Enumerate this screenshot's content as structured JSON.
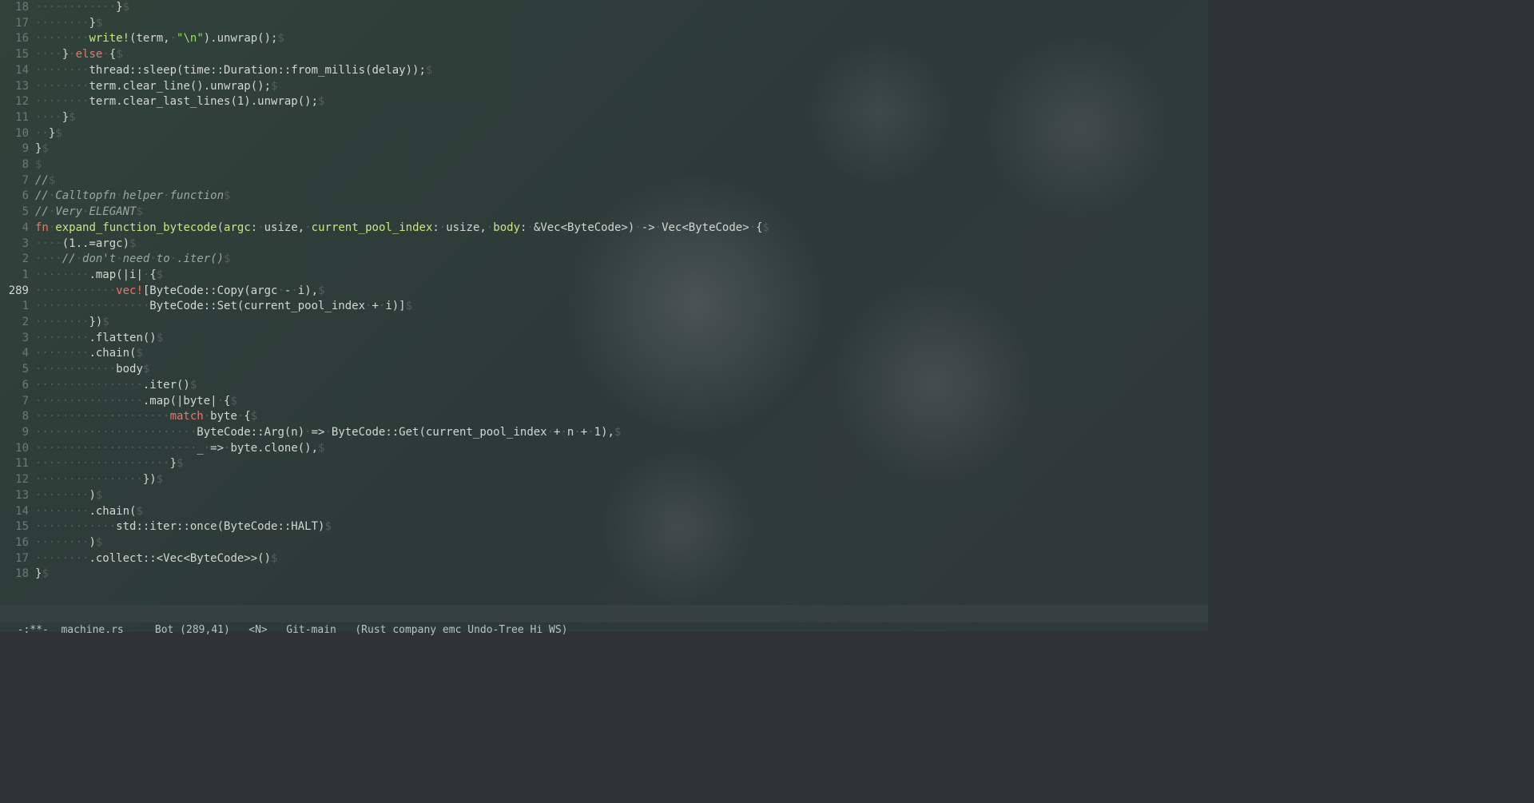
{
  "modeline": {
    "prefix": "-:**-  ",
    "filename": "machine.rs",
    "position": "Bot (289,41)",
    "mode_indicator": "<N>",
    "git": "Git-main",
    "modes": "(Rust company emc Undo-Tree Hi WS)"
  },
  "lines": [
    {
      "num": "18",
      "tokens": [
        [
          "ws",
          "············"
        ],
        [
          "punct",
          "}"
        ],
        [
          "eol",
          "$"
        ]
      ]
    },
    {
      "num": "17",
      "tokens": [
        [
          "ws",
          "········"
        ],
        [
          "punct",
          "}"
        ],
        [
          "eol",
          "$"
        ]
      ]
    },
    {
      "num": "16",
      "tokens": [
        [
          "ws",
          "········"
        ],
        [
          "fn-name",
          "write!"
        ],
        [
          "punct",
          "(term,"
        ],
        [
          "ws",
          "·"
        ],
        [
          "string",
          "\"\\n\""
        ],
        [
          "punct",
          ").unwrap();"
        ],
        [
          "eol",
          "$"
        ]
      ]
    },
    {
      "num": "15",
      "tokens": [
        [
          "ws",
          "····"
        ],
        [
          "punct",
          "}"
        ],
        [
          "ws",
          "·"
        ],
        [
          "kw",
          "else"
        ],
        [
          "ws",
          "·"
        ],
        [
          "punct",
          "{"
        ],
        [
          "eol",
          "$"
        ]
      ]
    },
    {
      "num": "14",
      "tokens": [
        [
          "ws",
          "········"
        ],
        [
          "punct",
          "thread::sleep(time::Duration::from_millis(delay));"
        ],
        [
          "eol",
          "$"
        ]
      ]
    },
    {
      "num": "13",
      "tokens": [
        [
          "ws",
          "········"
        ],
        [
          "punct",
          "term.clear_line().unwrap();"
        ],
        [
          "eol",
          "$"
        ]
      ]
    },
    {
      "num": "12",
      "tokens": [
        [
          "ws",
          "········"
        ],
        [
          "punct",
          "term.clear_last_lines(1).unwrap();"
        ],
        [
          "eol",
          "$"
        ]
      ]
    },
    {
      "num": "11",
      "tokens": [
        [
          "ws",
          "····"
        ],
        [
          "punct",
          "}"
        ],
        [
          "eol",
          "$"
        ]
      ]
    },
    {
      "num": "10",
      "tokens": [
        [
          "ws",
          "··"
        ],
        [
          "punct",
          "}"
        ],
        [
          "eol",
          "$"
        ]
      ]
    },
    {
      "num": "9",
      "tokens": [
        [
          "punct",
          "}"
        ],
        [
          "eol",
          "$"
        ]
      ]
    },
    {
      "num": "8",
      "tokens": [
        [
          "eol",
          "$"
        ]
      ]
    },
    {
      "num": "7",
      "tokens": [
        [
          "comment",
          "//"
        ],
        [
          "eol",
          "$"
        ]
      ]
    },
    {
      "num": "6",
      "tokens": [
        [
          "comment",
          "//"
        ],
        [
          "ws",
          "·"
        ],
        [
          "comment",
          "Calltopfn"
        ],
        [
          "ws",
          "·"
        ],
        [
          "comment",
          "helper"
        ],
        [
          "ws",
          "·"
        ],
        [
          "comment",
          "function"
        ],
        [
          "eol",
          "$"
        ]
      ]
    },
    {
      "num": "5",
      "tokens": [
        [
          "comment",
          "//"
        ],
        [
          "ws",
          "·"
        ],
        [
          "comment",
          "Very"
        ],
        [
          "ws",
          "·"
        ],
        [
          "comment",
          "ELEGANT"
        ],
        [
          "eol",
          "$"
        ]
      ]
    },
    {
      "num": "4",
      "tokens": [
        [
          "kw",
          "fn"
        ],
        [
          "ws",
          "·"
        ],
        [
          "fn-name",
          "expand_function_bytecode"
        ],
        [
          "punct",
          "("
        ],
        [
          "fn-name",
          "argc"
        ],
        [
          "punct",
          ":"
        ],
        [
          "ws",
          "·"
        ],
        [
          "type",
          "usize"
        ],
        [
          "punct",
          ","
        ],
        [
          "ws",
          "·"
        ],
        [
          "fn-name",
          "current_pool_index"
        ],
        [
          "punct",
          ":"
        ],
        [
          "ws",
          "·"
        ],
        [
          "type",
          "usize"
        ],
        [
          "punct",
          ","
        ],
        [
          "ws",
          "·"
        ],
        [
          "fn-name",
          "body"
        ],
        [
          "punct",
          ":"
        ],
        [
          "ws",
          "·"
        ],
        [
          "punct",
          "&"
        ],
        [
          "type",
          "Vec<ByteCode>"
        ],
        [
          "punct",
          ")"
        ],
        [
          "ws",
          "·"
        ],
        [
          "punct",
          "->"
        ],
        [
          "ws",
          "·"
        ],
        [
          "type",
          "Vec<ByteCode>"
        ],
        [
          "ws",
          "·"
        ],
        [
          "punct",
          "{"
        ],
        [
          "eol",
          "$"
        ]
      ]
    },
    {
      "num": "3",
      "tokens": [
        [
          "ws",
          "····"
        ],
        [
          "punct",
          "(1..=argc)"
        ],
        [
          "eol",
          "$"
        ]
      ]
    },
    {
      "num": "2",
      "tokens": [
        [
          "ws",
          "····"
        ],
        [
          "comment",
          "//"
        ],
        [
          "ws",
          "·"
        ],
        [
          "comment",
          "don't"
        ],
        [
          "ws",
          "·"
        ],
        [
          "comment",
          "need"
        ],
        [
          "ws",
          "·"
        ],
        [
          "comment",
          "to"
        ],
        [
          "ws",
          "·"
        ],
        [
          "comment",
          ".iter()"
        ],
        [
          "eol",
          "$"
        ]
      ]
    },
    {
      "num": "1",
      "tokens": [
        [
          "ws",
          "········"
        ],
        [
          "punct",
          ".map(|i|"
        ],
        [
          "ws",
          "·"
        ],
        [
          "punct",
          "{"
        ],
        [
          "eol",
          "$"
        ]
      ]
    },
    {
      "num": "289",
      "current": true,
      "tokens": [
        [
          "ws",
          "············"
        ],
        [
          "macro",
          "vec!"
        ],
        [
          "punct",
          "[ByteCode::Copy(argc"
        ],
        [
          "ws",
          "·"
        ],
        [
          "punct",
          "-"
        ],
        [
          "ws",
          "·"
        ],
        [
          "punct",
          "i),"
        ],
        [
          "eol",
          "$"
        ]
      ]
    },
    {
      "num": "1",
      "tokens": [
        [
          "ws",
          "·················"
        ],
        [
          "punct",
          "ByteCode::Set(current_pool_index"
        ],
        [
          "ws",
          "·"
        ],
        [
          "punct",
          "+"
        ],
        [
          "ws",
          "·"
        ],
        [
          "punct",
          "i)]"
        ],
        [
          "eol",
          "$"
        ]
      ]
    },
    {
      "num": "2",
      "tokens": [
        [
          "ws",
          "········"
        ],
        [
          "punct",
          "})"
        ],
        [
          "eol",
          "$"
        ]
      ]
    },
    {
      "num": "3",
      "tokens": [
        [
          "ws",
          "········"
        ],
        [
          "punct",
          ".flatten()"
        ],
        [
          "eol",
          "$"
        ]
      ]
    },
    {
      "num": "4",
      "tokens": [
        [
          "ws",
          "········"
        ],
        [
          "punct",
          ".chain("
        ],
        [
          "eol",
          "$"
        ]
      ]
    },
    {
      "num": "5",
      "tokens": [
        [
          "ws",
          "············"
        ],
        [
          "punct",
          "body"
        ],
        [
          "eol",
          "$"
        ]
      ]
    },
    {
      "num": "6",
      "tokens": [
        [
          "ws",
          "················"
        ],
        [
          "punct",
          ".iter()"
        ],
        [
          "eol",
          "$"
        ]
      ]
    },
    {
      "num": "7",
      "tokens": [
        [
          "ws",
          "················"
        ],
        [
          "punct",
          ".map(|byte|"
        ],
        [
          "ws",
          "·"
        ],
        [
          "punct",
          "{"
        ],
        [
          "eol",
          "$"
        ]
      ]
    },
    {
      "num": "8",
      "tokens": [
        [
          "ws",
          "····················"
        ],
        [
          "kw",
          "match"
        ],
        [
          "ws",
          "·"
        ],
        [
          "punct",
          "byte"
        ],
        [
          "ws",
          "·"
        ],
        [
          "punct",
          "{"
        ],
        [
          "eol",
          "$"
        ]
      ]
    },
    {
      "num": "9",
      "tokens": [
        [
          "ws",
          "························"
        ],
        [
          "punct",
          "ByteCode::Arg(n)"
        ],
        [
          "ws",
          "·"
        ],
        [
          "punct",
          "=>"
        ],
        [
          "ws",
          "·"
        ],
        [
          "punct",
          "ByteCode::Get(current_pool_index"
        ],
        [
          "ws",
          "·"
        ],
        [
          "punct",
          "+"
        ],
        [
          "ws",
          "·"
        ],
        [
          "punct",
          "n"
        ],
        [
          "ws",
          "·"
        ],
        [
          "punct",
          "+"
        ],
        [
          "ws",
          "·"
        ],
        [
          "punct",
          "1),"
        ],
        [
          "eol",
          "$"
        ]
      ]
    },
    {
      "num": "10",
      "tokens": [
        [
          "ws",
          "························"
        ],
        [
          "punct",
          "_"
        ],
        [
          "ws",
          "·"
        ],
        [
          "punct",
          "=>"
        ],
        [
          "ws",
          "·"
        ],
        [
          "punct",
          "byte.clone(),"
        ],
        [
          "eol",
          "$"
        ]
      ]
    },
    {
      "num": "11",
      "tokens": [
        [
          "ws",
          "····················"
        ],
        [
          "punct",
          "}"
        ],
        [
          "eol",
          "$"
        ]
      ]
    },
    {
      "num": "12",
      "tokens": [
        [
          "ws",
          "················"
        ],
        [
          "punct",
          "})"
        ],
        [
          "eol",
          "$"
        ]
      ]
    },
    {
      "num": "13",
      "tokens": [
        [
          "ws",
          "········"
        ],
        [
          "punct",
          ")"
        ],
        [
          "eol",
          "$"
        ]
      ]
    },
    {
      "num": "14",
      "tokens": [
        [
          "ws",
          "········"
        ],
        [
          "punct",
          ".chain("
        ],
        [
          "eol",
          "$"
        ]
      ]
    },
    {
      "num": "15",
      "tokens": [
        [
          "ws",
          "············"
        ],
        [
          "punct",
          "std::iter::once(ByteCode::HALT)"
        ],
        [
          "eol",
          "$"
        ]
      ]
    },
    {
      "num": "16",
      "tokens": [
        [
          "ws",
          "········"
        ],
        [
          "punct",
          ")"
        ],
        [
          "eol",
          "$"
        ]
      ]
    },
    {
      "num": "17",
      "tokens": [
        [
          "ws",
          "········"
        ],
        [
          "punct",
          ".collect::<Vec<ByteCode>>()"
        ],
        [
          "eol",
          "$"
        ]
      ]
    },
    {
      "num": "18",
      "tokens": [
        [
          "punct",
          "}"
        ],
        [
          "eol",
          "$"
        ]
      ]
    }
  ]
}
